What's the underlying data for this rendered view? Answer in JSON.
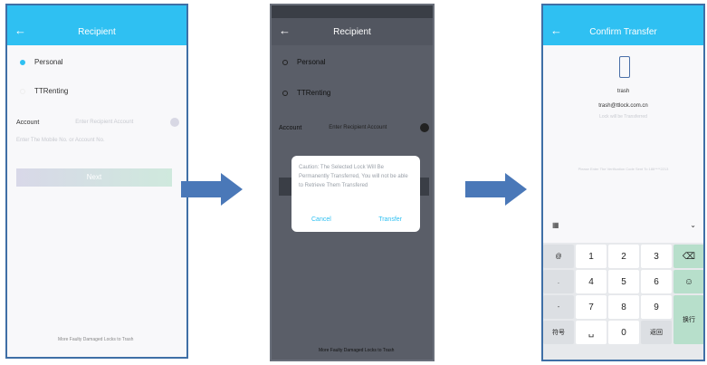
{
  "screen1": {
    "title": "Recipient",
    "options": [
      "Personal",
      "TTRenting"
    ],
    "account_label": "Account",
    "account_placeholder": "Enter Recipient Account",
    "hint": "Enter The Mobile No. or Account No.",
    "next_button": "Next",
    "footer": "More Faulty Damaged Locks to Trash"
  },
  "screen2": {
    "title": "Recipient",
    "options": [
      "Personal",
      "TTRenting"
    ],
    "account_label": "Account",
    "account_value": "Enter Recipient Account",
    "dialog_message": "Caution: The Selected Lock Will Be Permanently Transferred, You will not be able to Retrieve Them Transfered",
    "dialog_cancel": "Cancel",
    "dialog_transfer": "Transfer",
    "footer": "More Faulty Damaged Locks to Trash"
  },
  "screen3": {
    "title": "Confirm Transfer",
    "name": "trash",
    "email": "trash@ttlock.com.cn",
    "subtext": "Lock will be Transferred",
    "code_hint": "Please Enter The Verification Code Sent To 186****2213",
    "keyboard": {
      "digits": [
        "1",
        "2",
        "3",
        "4",
        "5",
        "6",
        "7",
        "8",
        "9",
        "0"
      ],
      "symbol_key": "符号",
      "return_key": "返回",
      "newline_key": "换行"
    }
  },
  "colors": {
    "accent": "#2fc0f2",
    "frame": "#3f6fa6",
    "arrow": "#4a78b8"
  }
}
